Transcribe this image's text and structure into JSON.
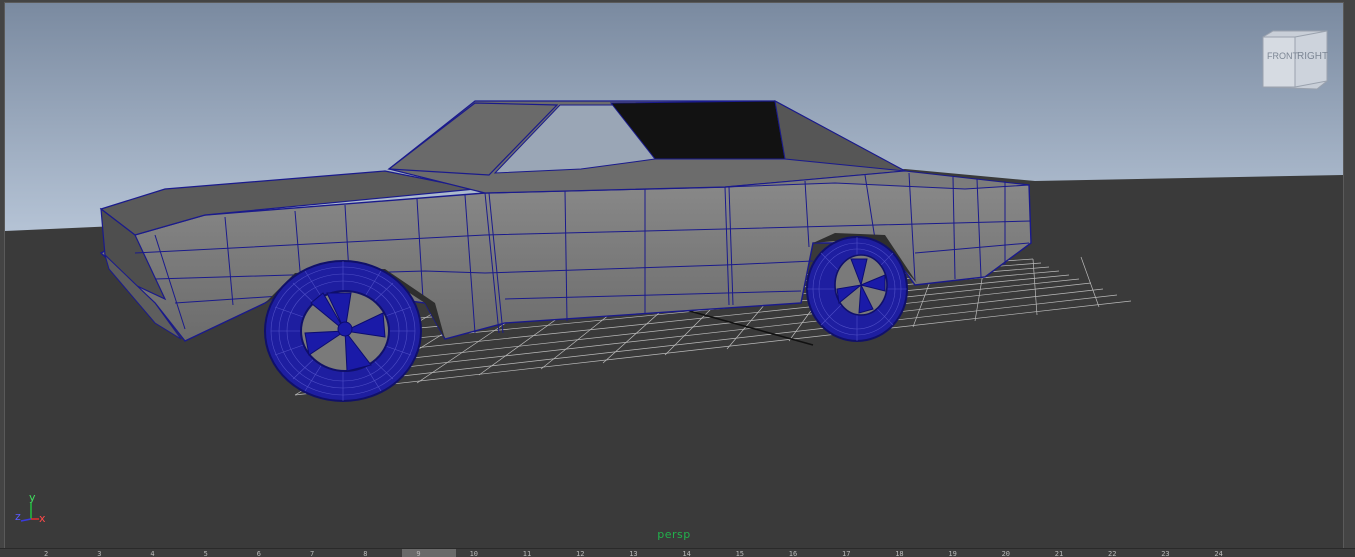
{
  "viewport": {
    "camera_label": "persp",
    "view_cube": {
      "front_label": "FRONT",
      "right_label": "RIGHT"
    },
    "axis_gizmo": {
      "y_label": "y",
      "z_label": "z",
      "x_label": "x"
    }
  },
  "timeline": {
    "ticks": [
      "2",
      "3",
      "4",
      "5",
      "6",
      "7",
      "8",
      "9",
      "10",
      "11",
      "12",
      "13",
      "14",
      "15",
      "16",
      "17",
      "18",
      "19",
      "20",
      "21",
      "22",
      "23",
      "24"
    ]
  },
  "colors": {
    "sky_top": "#7e8ea4",
    "sky_bottom": "#b4c2d4",
    "ground": "#3a3a3a",
    "car_body": "#787878",
    "wireframe": "#1a1a8c",
    "wheel": "#1c1ca0",
    "grid": "#d8d8d8",
    "camera_label": "#22b24c"
  }
}
